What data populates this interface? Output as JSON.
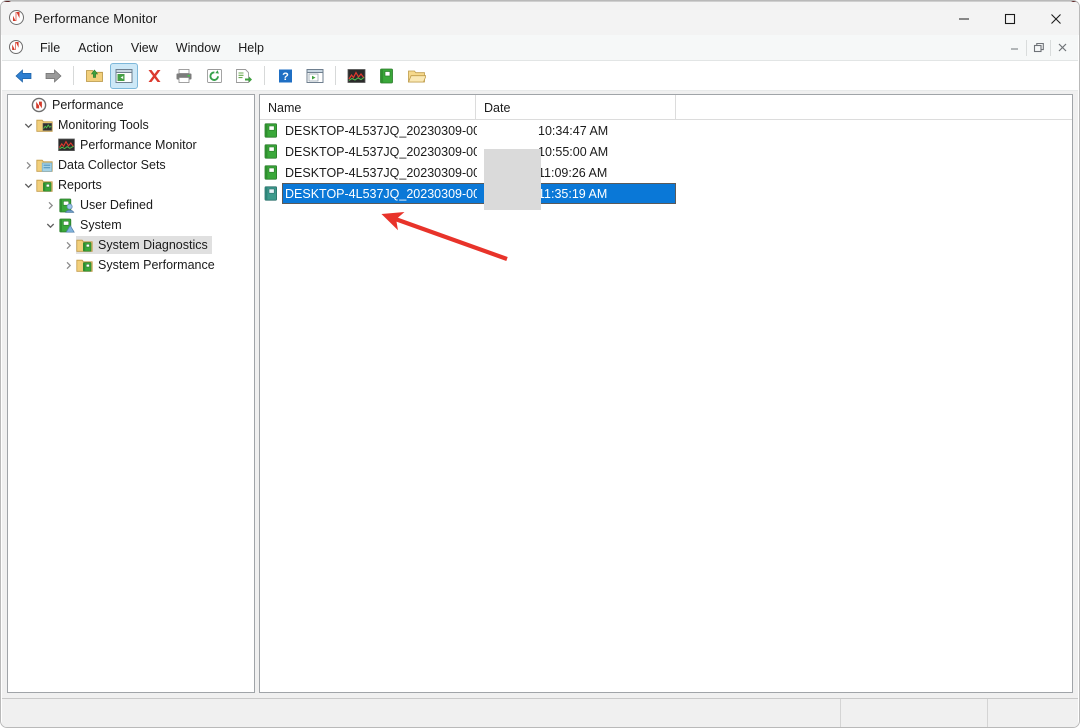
{
  "window": {
    "title": "Performance Monitor",
    "app_icon": "performance-monitor-icon",
    "controls": {
      "minimize": "Minimize",
      "maximize": "Maximize",
      "close": "Close"
    }
  },
  "menubar": {
    "system_icon": "performance-monitor-icon",
    "items": [
      {
        "label": "File"
      },
      {
        "label": "Action"
      },
      {
        "label": "View"
      },
      {
        "label": "Window"
      },
      {
        "label": "Help"
      }
    ],
    "mdi_controls": {
      "minimize": "Minimize child window",
      "restore": "Restore child window",
      "close": "Close child window"
    }
  },
  "toolbar": {
    "buttons": [
      {
        "name": "back-arrow-icon",
        "label": "Back",
        "active": false
      },
      {
        "name": "forward-arrow-icon",
        "label": "Forward",
        "active": false
      },
      {
        "name": "up-folder-icon",
        "label": "Up one level",
        "active": false
      },
      {
        "name": "show-hide-console-tree-icon",
        "label": "Show/Hide Console Tree",
        "active": true
      },
      {
        "name": "delete-red-x-icon",
        "label": "Delete",
        "active": false
      },
      {
        "name": "printer-icon",
        "label": "Print",
        "active": false
      },
      {
        "name": "refresh-icon",
        "label": "Refresh",
        "active": false
      },
      {
        "name": "export-list-icon",
        "label": "Export List",
        "active": false
      },
      {
        "name": "help-question-icon",
        "label": "Help",
        "active": false
      },
      {
        "name": "new-window-icon",
        "label": "New Window",
        "active": false
      },
      {
        "name": "performance-graph-icon",
        "label": "Performance Monitor View",
        "active": false
      },
      {
        "name": "report-green-icon",
        "label": "Report View",
        "active": false
      },
      {
        "name": "folder-open-icon",
        "label": "Open Folder",
        "active": false
      }
    ]
  },
  "tree": {
    "items": [
      {
        "label": "Performance",
        "indent": 0,
        "expander": "none",
        "icon": "performance-monitor-icon",
        "selected": false
      },
      {
        "label": "Monitoring Tools",
        "indent": 1,
        "expander": "expanded",
        "icon": "folder-monitor-icon",
        "selected": false
      },
      {
        "label": "Performance Monitor",
        "indent": 2,
        "expander": "none",
        "icon": "performance-graph-icon",
        "selected": false
      },
      {
        "label": "Data Collector Sets",
        "indent": 1,
        "expander": "collapsed",
        "icon": "folder-datacollector-icon",
        "selected": false
      },
      {
        "label": "Reports",
        "indent": 1,
        "expander": "expanded",
        "icon": "folder-report-icon",
        "selected": false
      },
      {
        "label": "User Defined",
        "indent": 2,
        "expander": "collapsed",
        "icon": "user-defined-icon",
        "selected": false
      },
      {
        "label": "System",
        "indent": 2,
        "expander": "expanded",
        "icon": "system-reports-icon",
        "selected": false
      },
      {
        "label": "System Diagnostics",
        "indent": 3,
        "expander": "collapsed",
        "icon": "folder-report-icon",
        "selected": true
      },
      {
        "label": "System Performance",
        "indent": 3,
        "expander": "collapsed",
        "icon": "folder-report-icon",
        "selected": false
      }
    ]
  },
  "list": {
    "columns": [
      {
        "key": "name",
        "label": "Name"
      },
      {
        "key": "date",
        "label": "Date"
      }
    ],
    "rows": [
      {
        "icon": "report-green-icon",
        "name": "DESKTOP-4L537JQ_20230309-00...",
        "date_redacted": "",
        "time": "10:34:47 AM",
        "selected": false
      },
      {
        "icon": "report-green-icon",
        "name": "DESKTOP-4L537JQ_20230309-00...",
        "date_redacted": "",
        "time": "10:55:00 AM",
        "selected": false
      },
      {
        "icon": "report-green-icon",
        "name": "DESKTOP-4L537JQ_20230309-00...",
        "date_redacted": "",
        "time": "11:09:26 AM",
        "selected": false
      },
      {
        "icon": "report-green-icon",
        "name": "DESKTOP-4L537JQ_20230309-00...",
        "date_redacted": "",
        "time": "11:35:19 AM",
        "selected": true
      }
    ],
    "redaction": {
      "name": "date-redaction-block",
      "color": "#dadada"
    }
  },
  "statusbar": {
    "main": "",
    "pane2": "",
    "pane3": ""
  },
  "annotation": {
    "name": "red-arrow-annotation",
    "color": "#e8332a",
    "points_to": "selected report row"
  },
  "colors": {
    "selection_blue": "#0a78d7",
    "tree_selection_gray": "#e0e0e0",
    "accent_red": "#e8332a",
    "window_chrome": "#f3f3f3",
    "menubar": "#f6f8f8",
    "content_bg": "#f0f0f0"
  }
}
